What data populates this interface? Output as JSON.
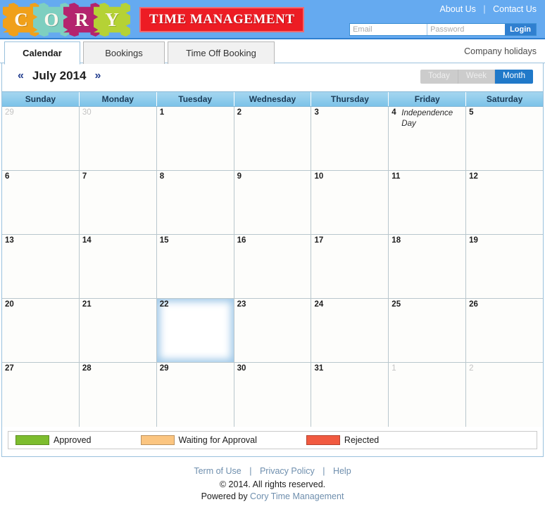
{
  "header": {
    "logo_letters": [
      {
        "letter": "C",
        "color": "#f0a01a"
      },
      {
        "letter": "O",
        "color": "#7ecfc0"
      },
      {
        "letter": "R",
        "color": "#b4246e"
      },
      {
        "letter": "Y",
        "color": "#b5d235"
      }
    ],
    "brand": "TIME MANAGEMENT",
    "about_us": "About Us",
    "separator": "|",
    "contact_us": "Contact Us",
    "email_placeholder": "Email",
    "email_value": "",
    "password_placeholder": "Password",
    "password_value": "",
    "login_label": "Login",
    "bg_color": "#65aaf0",
    "brand_color": "#ed1c24"
  },
  "tabs": [
    {
      "label": "Calendar",
      "active": true
    },
    {
      "label": "Bookings",
      "active": false
    },
    {
      "label": "Time Off Booking",
      "active": false
    }
  ],
  "company_holidays_link": "Company holidays",
  "calendar": {
    "prev_arrow": "«",
    "next_arrow": "»",
    "month_label": "July 2014",
    "views": [
      {
        "label": "Today",
        "active": false
      },
      {
        "label": "Week",
        "active": false
      },
      {
        "label": "Month",
        "active": true
      }
    ],
    "day_names": [
      "Sunday",
      "Monday",
      "Tuesday",
      "Wednesday",
      "Thursday",
      "Friday",
      "Saturday"
    ],
    "weeks": [
      [
        {
          "num": "29",
          "other": true,
          "today": false,
          "event": ""
        },
        {
          "num": "30",
          "other": true,
          "today": false,
          "event": ""
        },
        {
          "num": "1",
          "other": false,
          "today": false,
          "event": ""
        },
        {
          "num": "2",
          "other": false,
          "today": false,
          "event": ""
        },
        {
          "num": "3",
          "other": false,
          "today": false,
          "event": ""
        },
        {
          "num": "4",
          "other": false,
          "today": false,
          "event": "Independence Day"
        },
        {
          "num": "5",
          "other": false,
          "today": false,
          "event": ""
        }
      ],
      [
        {
          "num": "6",
          "other": false,
          "today": false,
          "event": ""
        },
        {
          "num": "7",
          "other": false,
          "today": false,
          "event": ""
        },
        {
          "num": "8",
          "other": false,
          "today": false,
          "event": ""
        },
        {
          "num": "9",
          "other": false,
          "today": false,
          "event": ""
        },
        {
          "num": "10",
          "other": false,
          "today": false,
          "event": ""
        },
        {
          "num": "11",
          "other": false,
          "today": false,
          "event": ""
        },
        {
          "num": "12",
          "other": false,
          "today": false,
          "event": ""
        }
      ],
      [
        {
          "num": "13",
          "other": false,
          "today": false,
          "event": ""
        },
        {
          "num": "14",
          "other": false,
          "today": false,
          "event": ""
        },
        {
          "num": "15",
          "other": false,
          "today": false,
          "event": ""
        },
        {
          "num": "16",
          "other": false,
          "today": false,
          "event": ""
        },
        {
          "num": "17",
          "other": false,
          "today": false,
          "event": ""
        },
        {
          "num": "18",
          "other": false,
          "today": false,
          "event": ""
        },
        {
          "num": "19",
          "other": false,
          "today": false,
          "event": ""
        }
      ],
      [
        {
          "num": "20",
          "other": false,
          "today": false,
          "event": ""
        },
        {
          "num": "21",
          "other": false,
          "today": false,
          "event": ""
        },
        {
          "num": "22",
          "other": false,
          "today": true,
          "event": ""
        },
        {
          "num": "23",
          "other": false,
          "today": false,
          "event": ""
        },
        {
          "num": "24",
          "other": false,
          "today": false,
          "event": ""
        },
        {
          "num": "25",
          "other": false,
          "today": false,
          "event": ""
        },
        {
          "num": "26",
          "other": false,
          "today": false,
          "event": ""
        }
      ],
      [
        {
          "num": "27",
          "other": false,
          "today": false,
          "event": ""
        },
        {
          "num": "28",
          "other": false,
          "today": false,
          "event": ""
        },
        {
          "num": "29",
          "other": false,
          "today": false,
          "event": ""
        },
        {
          "num": "30",
          "other": false,
          "today": false,
          "event": ""
        },
        {
          "num": "31",
          "other": false,
          "today": false,
          "event": ""
        },
        {
          "num": "1",
          "other": true,
          "today": false,
          "event": ""
        },
        {
          "num": "2",
          "other": true,
          "today": false,
          "event": ""
        }
      ]
    ]
  },
  "legend": [
    {
      "label": "Approved",
      "color": "#7dbd2e"
    },
    {
      "label": "Waiting for Approval",
      "color": "#fbc580"
    },
    {
      "label": "Rejected",
      "color": "#f15a40"
    }
  ],
  "footer": {
    "links": [
      "Term of Use",
      "Privacy Policy",
      "Help"
    ],
    "separator": "|",
    "copyright": "© 2014. All rights reserved.",
    "powered_prefix": "Powered by ",
    "powered_name": "Cory Time Management"
  }
}
